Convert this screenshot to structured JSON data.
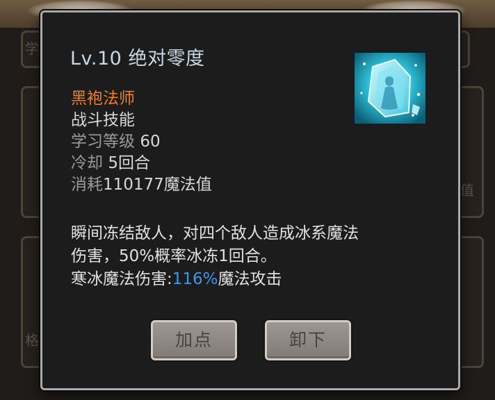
{
  "background": {
    "glyphs": [
      "学",
      "值",
      "格"
    ]
  },
  "dialog": {
    "title": "Lv.10 绝对零度",
    "skill_icon": "ice-crystal-figure-icon",
    "class_name": "黑袍法师",
    "skill_type": "战斗技能",
    "learn_level_label": "学习等级",
    "learn_level_value": "60",
    "cooldown_label": "冷却",
    "cooldown_value": "5回合",
    "cost_label": "消耗",
    "cost_value": "110177魔法值",
    "description": {
      "line1": "瞬间冻结敌人，对四个敌人造成冰系魔法",
      "line2": "伤害，50%概率冰冻1回合。",
      "line3_prefix": "寒冰魔法伤害:",
      "line3_highlight": "116%",
      "line3_suffix": "魔法攻击"
    },
    "buttons": {
      "add_point": "加点",
      "unequip": "卸下"
    }
  },
  "colors": {
    "accent_orange": "#ee7f2f",
    "highlight_blue": "#3b98e8",
    "title_color": "#c9d9e6"
  }
}
